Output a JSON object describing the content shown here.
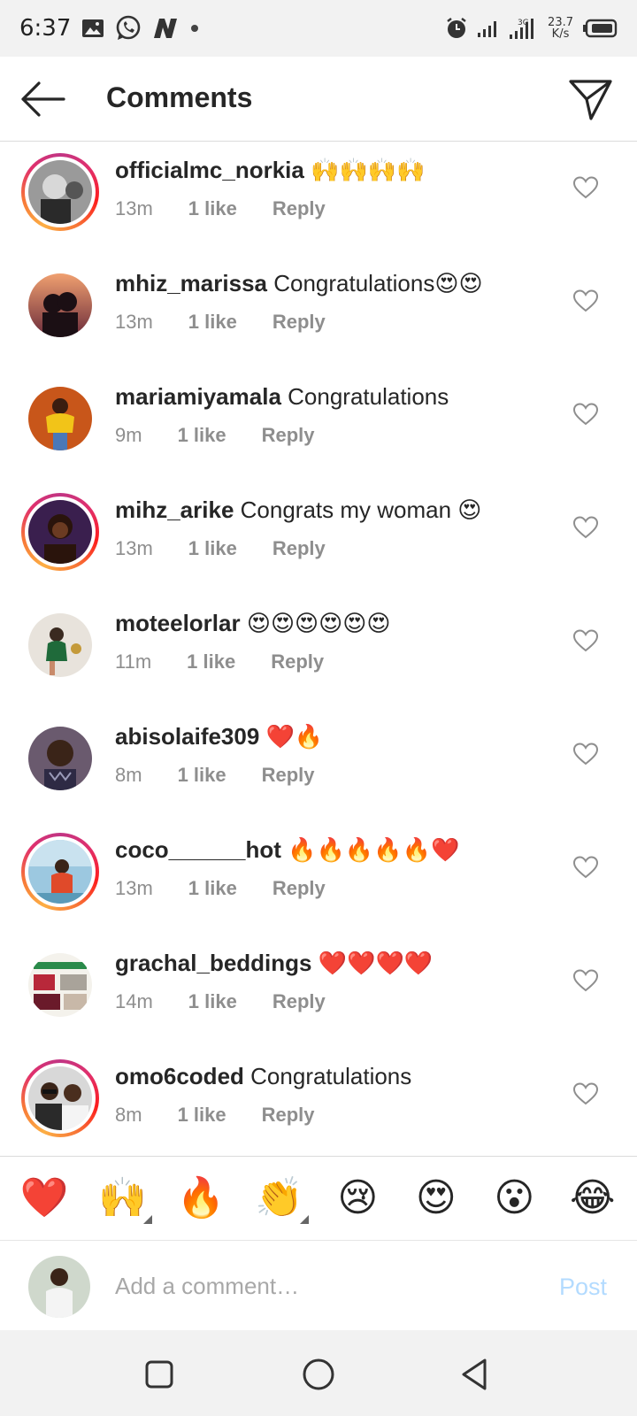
{
  "status_bar": {
    "time": "6:37",
    "network_type": "3G",
    "speed_value": "23.7",
    "speed_unit": "K/s",
    "icons": [
      "gallery-icon",
      "whatsapp-icon",
      "n-app-icon",
      "dot-icon",
      "alarm-icon",
      "signal-icon",
      "signal-3g-icon",
      "battery-icon"
    ]
  },
  "header": {
    "title": "Comments",
    "back_icon": "arrow-left-icon",
    "send_icon": "paper-plane-icon"
  },
  "comments": [
    {
      "username": "officialmc_norkia",
      "text": "🙌🙌🙌🙌",
      "time": "13m",
      "likes": "1 like",
      "reply": "Reply",
      "story_ring": true
    },
    {
      "username": "mhiz_marissa",
      "text": "Congratulations😍😍",
      "time": "13m",
      "likes": "1 like",
      "reply": "Reply",
      "story_ring": false
    },
    {
      "username": "mariamiyamala",
      "text": "Congratulations",
      "time": "9m",
      "likes": "1 like",
      "reply": "Reply",
      "story_ring": false
    },
    {
      "username": "mihz_arike",
      "text": "Congrats my woman 😍",
      "time": "13m",
      "likes": "1 like",
      "reply": "Reply",
      "story_ring": true
    },
    {
      "username": "moteelorlar",
      "text": "😍😍😍😍😍😍",
      "time": "11m",
      "likes": "1 like",
      "reply": "Reply",
      "story_ring": false
    },
    {
      "username": "abisolaife309",
      "text": "❤️🔥",
      "time": "8m",
      "likes": "1 like",
      "reply": "Reply",
      "story_ring": false
    },
    {
      "username": "coco______hot",
      "text": "🔥🔥🔥🔥🔥❤️",
      "time": "13m",
      "likes": "1 like",
      "reply": "Reply",
      "story_ring": true
    },
    {
      "username": "grachal_beddings",
      "text": "❤️❤️❤️❤️",
      "time": "14m",
      "likes": "1 like",
      "reply": "Reply",
      "story_ring": false
    },
    {
      "username": "omo6coded",
      "text": "Congratulations",
      "time": "8m",
      "likes": "1 like",
      "reply": "Reply",
      "story_ring": true
    }
  ],
  "emoji_bar": [
    "❤️",
    "🙌",
    "🔥",
    "👏",
    "😢",
    "😍",
    "😮",
    "😂"
  ],
  "composer": {
    "placeholder": "Add a comment…",
    "post_label": "Post"
  },
  "nav_bar": {
    "icons": [
      "recents-square-icon",
      "home-circle-icon",
      "back-triangle-icon"
    ]
  },
  "colors": {
    "accent_link": "#b3dbff",
    "meta_text": "#8e8e8e",
    "primary_text": "#262626",
    "story_ring": "#e1306c"
  }
}
